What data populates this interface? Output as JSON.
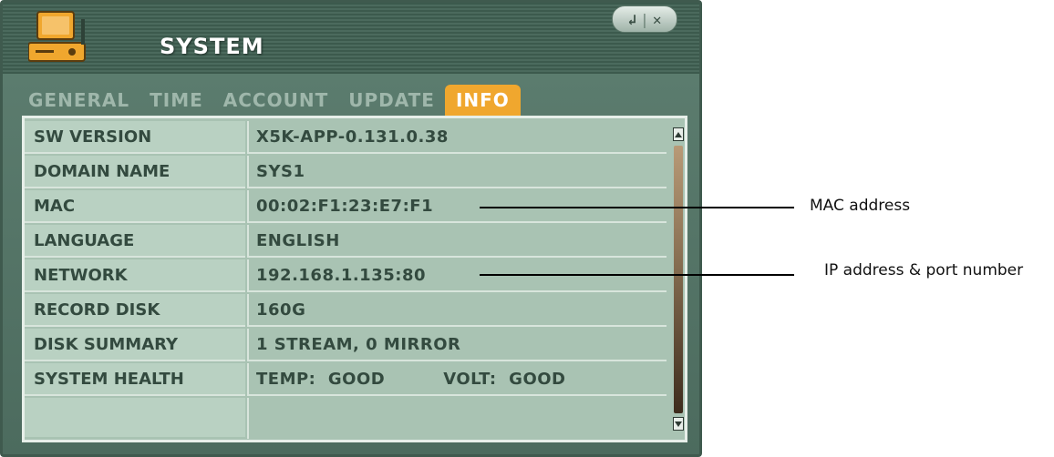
{
  "window": {
    "title": "SYSTEM",
    "controls": {
      "back_icon": "return-arrow-icon",
      "separator": "|",
      "close_icon": "close-x-icon"
    },
    "accent_color": "#f0a72e"
  },
  "tabs": [
    {
      "label": "GENERAL",
      "active": false
    },
    {
      "label": "TIME",
      "active": false
    },
    {
      "label": "ACCOUNT",
      "active": false
    },
    {
      "label": "UPDATE",
      "active": false
    },
    {
      "label": "INFO",
      "active": true
    }
  ],
  "info_rows": [
    {
      "label": "SW VERSION",
      "value": "X5K-APP-0.131.0.38"
    },
    {
      "label": "DOMAIN NAME",
      "value": "SYS1"
    },
    {
      "label": "MAC",
      "value": "00:02:F1:23:E7:F1"
    },
    {
      "label": "LANGUAGE",
      "value": "ENGLISH"
    },
    {
      "label": "NETWORK",
      "value": "192.168.1.135:80"
    },
    {
      "label": "RECORD DISK",
      "value": "160G"
    },
    {
      "label": "DISK SUMMARY",
      "value": "1 STREAM, 0 MIRROR"
    },
    {
      "label": "SYSTEM HEALTH",
      "temp": "TEMP:  GOOD",
      "volt": "VOLT:  GOOD"
    },
    {
      "label": "",
      "value": ""
    }
  ],
  "annotations": {
    "mac": "MAC address",
    "ip": "IP address & port number"
  }
}
